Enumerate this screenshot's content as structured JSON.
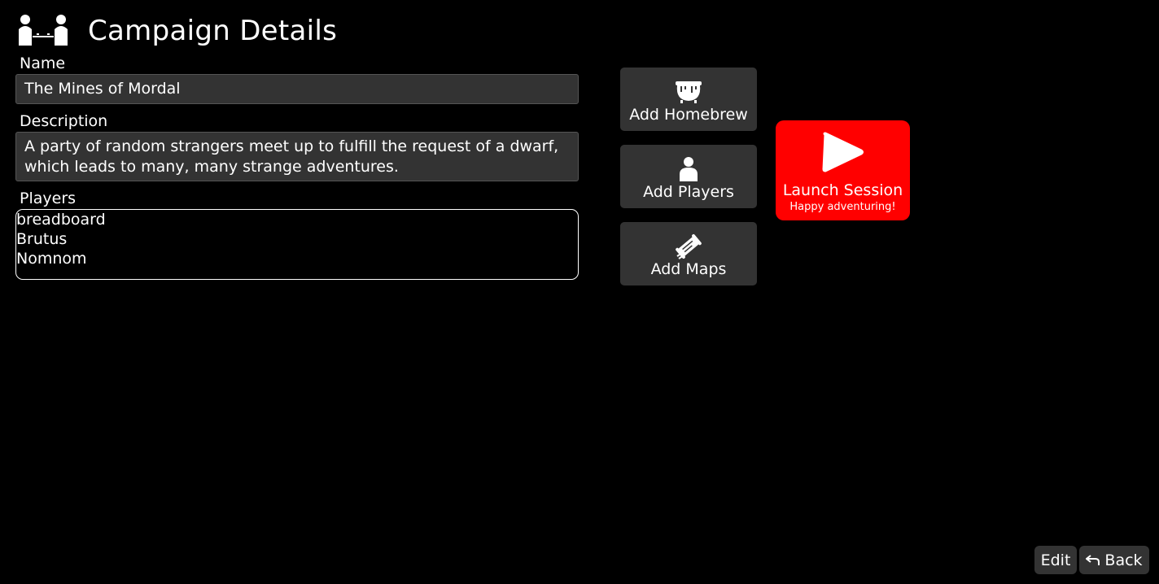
{
  "header": {
    "title": "Campaign Details",
    "logo_icon": "players-at-table-icon"
  },
  "form": {
    "name_label": "Name",
    "name_value": "The Mines of Mordal",
    "description_label": "Description",
    "description_line1": "A party of random strangers meet up to fulfill the request of a dwarf,",
    "description_line2": "which leads to many, many strange adventures.",
    "players_label": "Players",
    "players": [
      "breadboard",
      "Brutus",
      "Nomnom"
    ]
  },
  "actions": {
    "homebrew": {
      "label": "Add Homebrew",
      "icon": "cauldron-icon"
    },
    "players": {
      "label": "Add Players",
      "icon": "person-icon"
    },
    "maps": {
      "label": "Add Maps",
      "icon": "scroll-icon"
    }
  },
  "launch": {
    "title": "Launch Session",
    "subtitle": "Happy adventuring!",
    "icon": "play-icon",
    "color": "#ff0000"
  },
  "footer": {
    "edit_label": "Edit",
    "back_label": "Back",
    "back_icon": "undo-arrow-icon"
  },
  "colors": {
    "background": "#000000",
    "panel": "#333333",
    "text": "#ffffff"
  }
}
